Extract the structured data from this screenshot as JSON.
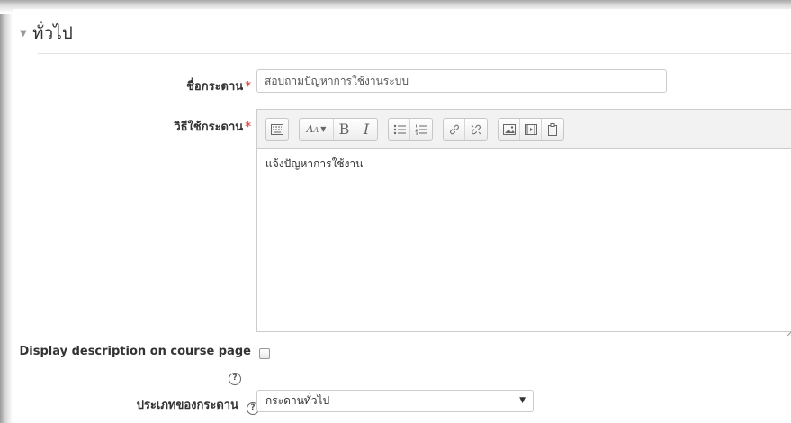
{
  "section": {
    "title": "ทั่วไป"
  },
  "fields": {
    "forum_name": {
      "label": "ชื่อกระดาน",
      "required_mark": "*",
      "value": "สอบถามปัญหาการใช้งานระบบ"
    },
    "description": {
      "label": "วิธีใช้กระดาน",
      "required_mark": "*",
      "content": "แจ้งปัญหาการใช้งาน"
    },
    "display_description": {
      "label": "Display description on course page",
      "checked": false
    },
    "forum_type": {
      "label": "ประเภทของกระดาน",
      "selected": "กระดานทั่วไป"
    }
  },
  "toolbar": {
    "groups": [
      [
        "keyboard-icon"
      ],
      [
        "font-size-icon",
        "bold-icon",
        "italic-icon"
      ],
      [
        "bullet-list-icon",
        "numbered-list-icon"
      ],
      [
        "link-icon",
        "unlink-icon"
      ],
      [
        "image-icon",
        "media-icon",
        "paste-icon"
      ]
    ]
  },
  "colors": {
    "required": "#d9534f",
    "border": "#cccccc",
    "toolbar_bg": "#f2f2f2"
  }
}
